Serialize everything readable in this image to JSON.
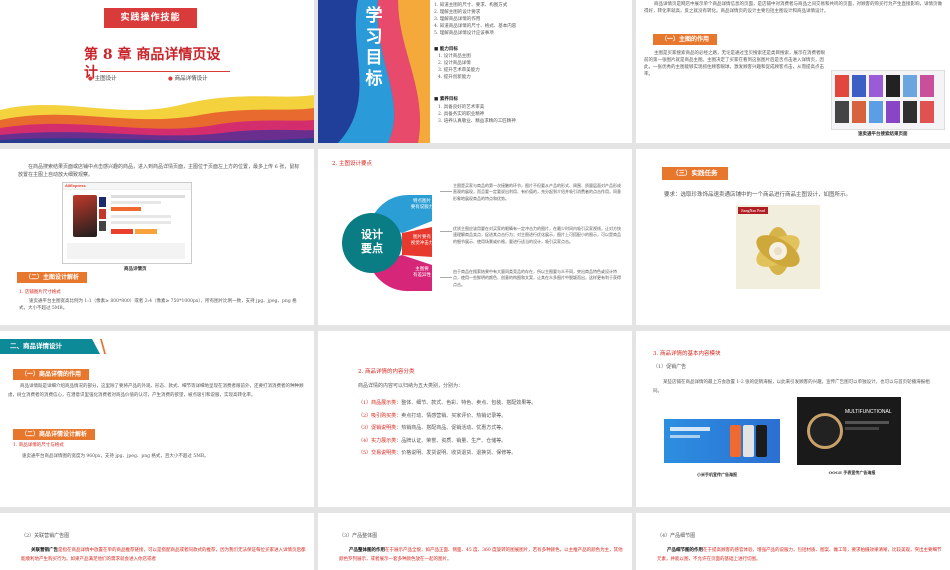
{
  "s1": {
    "banner": "实践操作技能",
    "chapter": "第 8 章",
    "title_a": "商品详情页设",
    "title_b": "计",
    "bullet1": "主图设计",
    "bullet2": "商品详情设计",
    "colors": {
      "banner": "#d93a3a",
      "title": "#c8242a"
    }
  },
  "s2": {
    "vertical_title": [
      "学",
      "习",
      "目",
      "标"
    ],
    "items": [
      "1. 知道主图的尺寸、要求、构图方式",
      "2. 理解主图的设计要求",
      "3. 理解商品详情的作用",
      "4. 知道商品详情的尺寸、格式、基本内容",
      "5. 理解商品详情设计应该事项"
    ],
    "h_ability": "能力目标",
    "ability_items": [
      "1. 设计商品主图",
      "2. 设计商品详情",
      "3. 提升艺术审美能力",
      "4. 提升创新能力"
    ],
    "h_quality": "素养目标",
    "quality_items": [
      "1. 具备良好的艺术审美",
      "2. 具备务实的职业精神",
      "3. 培养认真敬业、精益求精的工匠精神"
    ]
  },
  "s3": {
    "intro": "商品详情页是网店中展示单个商品详情信息的页面，是店铺中对消费者与商品之间交易和共鸣的页面，对顾客的购买行为产生直接影响，详情页做得好，转化率就高，反之就没有转化。商品详情页的设计主要包括主图设计和商品详情设计。",
    "tag": "（一）主图的作用",
    "body": "主图是买家搜索商品的必经之路，无论是通过宝贝搜索还是类目搜索，展示在消费者眼前的第一张图片就是商品主图。主图决定了买家在看到这张图片后是否点击进入详情页，因此，一张优秀的主图能够实现抓住顾客眼球，激发顾客兴趣和促成顾客点击，从而提高点击率。",
    "caption": "速卖通平台搜索结果页面"
  },
  "s4": {
    "body": "在商品搜索结果页面或店铺中点击感兴趣的商品，进入到商品详情页面，主图位于页面左上方的位置，最多上传 6 张，鼠标放置在主图上自动放大细致观察。",
    "shop_title": "AliExpress",
    "caption": "商品详情页",
    "tag": "（二）主图设计解析",
    "sub_heading": "1. 店铺图片尺寸格式",
    "sub_body": "速卖通平台主图宽高比例为 1:1（像素≥ 800*800）或者 3:4（像素≥ 750*1000px），所有图片比例一致，支持 jpg、jpeg、png 格式，大小不超过 5MB。"
  },
  "s5": {
    "heading": "2. 主图设计要点",
    "center": [
      "设计",
      "要点"
    ],
    "petal1": [
      "特点图片",
      "要有说服力"
    ],
    "petal2": [
      "图片要有",
      "视觉冲击力"
    ],
    "petal3": [
      "主图要",
      "有差异性"
    ],
    "p1": "主图是买家与商品的第一次接触的环节，图片不但要从产品的形式、周围、质量层面对产品形成直观的展现，而且要一定要说出利用、有价值的，充分起到介绍并吸引消费者的点击作用，同意形象地展现商品的特点和优势。",
    "p2": "优质主图应该用要在对买家的眼睛有一定冲击力的图片，在最少时间内吸引买家视线，让对方快速理解商品卖点，促进其点击行为；对主图进行优化展示，图片上可搭配小的图示，可以是商品的细节展示、使用场景或价格，要进行适当的设计，吸引买家点击。",
    "p3": "由于商品在搜索结果中有大量同类竞品的存在，所以主图要与众不同，突出商品特色或设计特点，使用一些鲜明的颜色、创意的构图和文案，让其在众多图片中脱颖而出，这样更有利于获得点击。"
  },
  "s6": {
    "tag": "（三）实践任务",
    "body": "要求：选取珍珠饰品速卖通店铺中的一个商品进行商品主图设计，如图所示。",
    "brand": "JiangNan Pearl"
  },
  "s7": {
    "heading_bar": "二、商品详情设计",
    "tag1": "（一）商品详情的作用",
    "p1": "商品详情既是详细介绍商品情况的部分，这里除了要将产品的外观、形态、款式、细节等详细地呈现在消费者眼前外，还要打消消费者的种种顾虑，树立消费者的消费信心，在潜意识里强化消费者对商品价值的认可，产生消费的欲望，被点吸引和说服，实现高转化率。",
    "tag2": "（二）商品详情设计解析",
    "sub_heading": "1. 商品详情的尺寸与格式",
    "sub_body": "速卖通平台商品详情图的宽度为 960px，支持 jpg、jpeg、png 格式，且大小不超过 5MB。"
  },
  "s8": {
    "heading": "2. 商品详情的内容分类",
    "intro": "商品详情的内容可以归纳为五大类别，分别为：",
    "rows": [
      {
        "label": "（1）商品展示类：",
        "text": "整体、细节、款式、色彩、特色、卖点、包装、搭配效果等。"
      },
      {
        "label": "（2）吸引购买类：",
        "text": "卖点打动、情感营销、买家评价、热销记录等。"
      },
      {
        "label": "（3）促销说明类：",
        "text": "热销商品、搭配商品、促销活动、优惠方式等。"
      },
      {
        "label": "（4）实力展示类：",
        "text": "品牌认证、荣誉、资质、销量、生产、仓储等。"
      },
      {
        "label": "（5）交易说明类：",
        "text": "价格说明、发货说明、收货退货、退换货、保修等。"
      }
    ]
  },
  "s9": {
    "heading": "3. 商品详情的基本内容模块",
    "sub": "（1）促销广告",
    "body": "某些店铺在商品详情的最上方会放置 1-2 张的促销海报，以此来引发顾客的兴趣，宣传广告图可以单独设计，也可以与首页轮播海报相同。",
    "cap1": "小米手机宣传广告海报",
    "cap2": "OOGE 手表宣传广告海报",
    "ad2_text": "MULTIFUNCTIONAL"
  },
  "s10": {
    "heading": "（2）关联营销广告图",
    "bold": "关联营销广告",
    "body": "是指在商品详情中放置在单的商品推荐链接，可以是搭配商品或者同款式的推荐，因为我们无法保证每位买家进入详情页后都能顺利地产生购买行为。如果产品满足他们的需求就会进入你店或者"
  },
  "s11": {
    "heading": "（3）产品整体图",
    "bold": "产品整体图的作用",
    "body": "在于展示产品全貌，如产品正面、侧面、45 度、360 度旋转的图展图片，若有多种颜色，以主推产品的颜色为主，其他颜色罗列展示，或者展示一套多种颜色放在一起的图片。"
  },
  "s12": {
    "heading": "（4）产品细节图",
    "bold": "产品细节图的作用",
    "body": "在于提高顾客的感官体验，增强产品的说服力，包括材质、图案、做工等，要求拍摄效果清晰，比较美观，突出主要细节元素，并能以图，不允许在页面的基础上进行切图。"
  }
}
